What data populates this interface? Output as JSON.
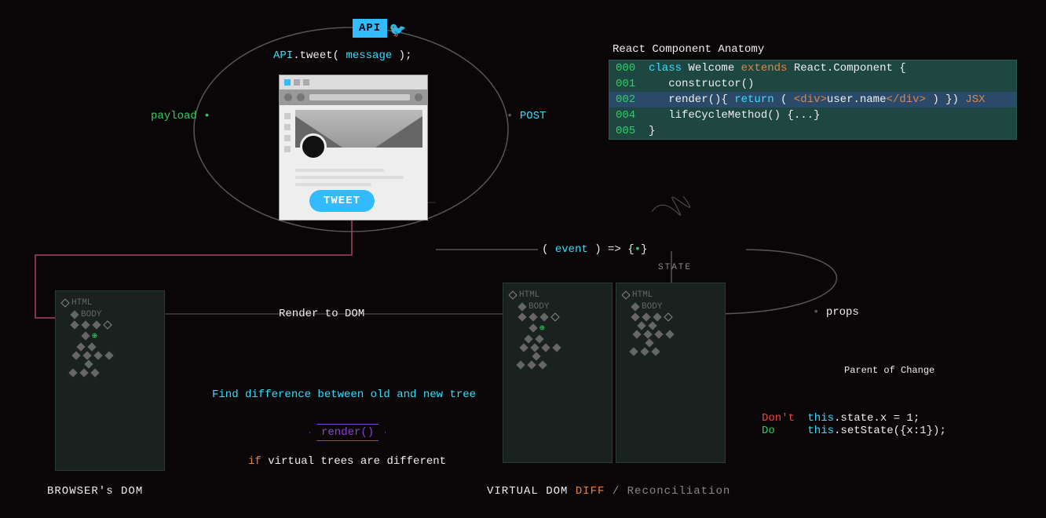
{
  "header": {
    "api_badge": "API",
    "api_call_prefix": "API",
    "api_call_dot": ".",
    "api_call_method": "tweet",
    "api_call_paren_open": "( ",
    "api_call_arg": "message",
    "api_call_paren_close": " );"
  },
  "labels": {
    "payload": "payload",
    "post": "POST",
    "render_to_dom": "Render to DOM",
    "find_diff": "Find difference between old and new tree",
    "render_fn": "render()",
    "if_word": "if",
    "if_rest": " virtual trees are different",
    "browsers_dom": "BROWSER's DOM",
    "virtual_dom": "VIRTUAL DOM",
    "diff_word": "DIFF",
    "reconciliation": " / Reconciliation",
    "event_open": "( ",
    "event_word": "event",
    "event_mid": " ) => {",
    "event_dot": "•",
    "event_close": "}",
    "state": "STATE",
    "props": "props",
    "parent_of_change": "Parent of Change",
    "dont": "Don't",
    "do": "Do",
    "dont_code_this": "this",
    "dont_code_rest": ".state.x = 1;",
    "do_code_this": "this",
    "do_code_rest": ".setState({x:1});"
  },
  "browser": {
    "tweet_button": "TWEET"
  },
  "tree": {
    "html": "HTML",
    "body": "BODY"
  },
  "code": {
    "title": "React Component Anatomy",
    "lines": [
      {
        "no": "000",
        "hl": false,
        "tokens": [
          {
            "t": "class ",
            "c": "cyan"
          },
          {
            "t": "Welcome ",
            "c": "white"
          },
          {
            "t": "extends ",
            "c": "orange"
          },
          {
            "t": "React.Component {",
            "c": "white"
          }
        ]
      },
      {
        "no": "001",
        "hl": false,
        "tokens": [
          {
            "t": "   constructor()",
            "c": "white"
          }
        ]
      },
      {
        "no": "002",
        "hl": true,
        "tokens": [
          {
            "t": "   render(){ ",
            "c": "white"
          },
          {
            "t": "return",
            "c": "cyan"
          },
          {
            "t": " ( ",
            "c": "white"
          },
          {
            "t": "<div>",
            "c": "orange"
          },
          {
            "t": "user.name",
            "c": "white"
          },
          {
            "t": "</div>",
            "c": "orange"
          },
          {
            "t": " ) }) ",
            "c": "white"
          },
          {
            "t": "JSX",
            "c": "orange"
          }
        ]
      },
      {
        "no": "004",
        "hl": false,
        "tokens": [
          {
            "t": "   lifeCycleMethod() {...}",
            "c": "white"
          }
        ]
      },
      {
        "no": "005",
        "hl": false,
        "tokens": [
          {
            "t": "}",
            "c": "white"
          }
        ]
      }
    ]
  }
}
